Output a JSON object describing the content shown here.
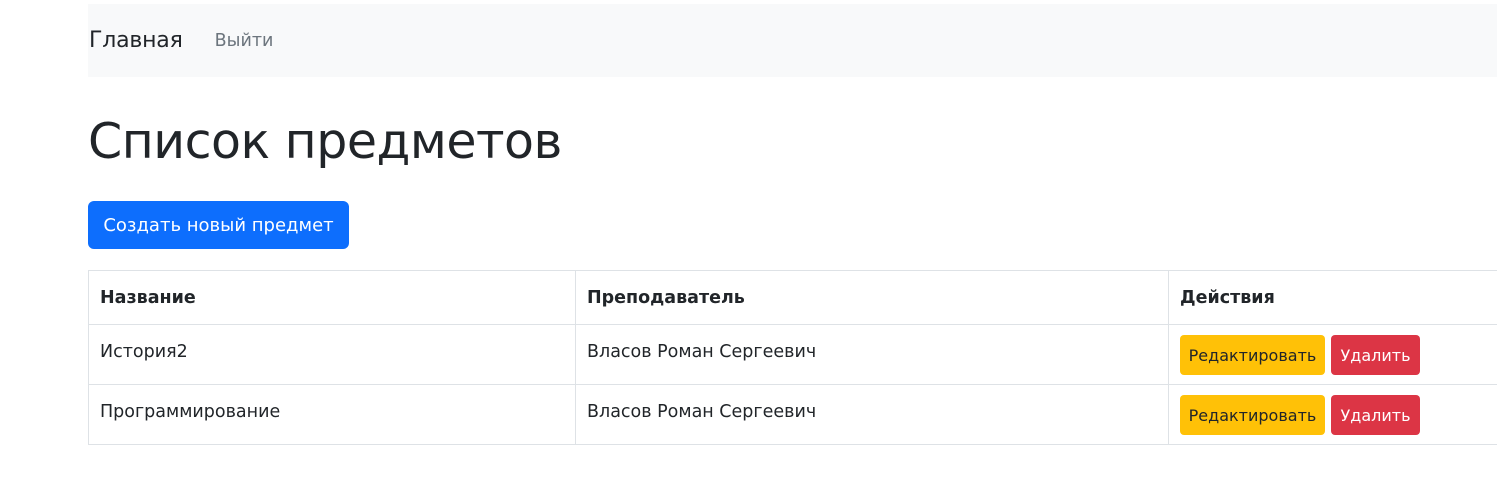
{
  "navbar": {
    "brand": "Главная",
    "logout_label": "Выйти"
  },
  "page": {
    "title": "Список предметов",
    "create_button_label": "Создать новый предмет"
  },
  "table": {
    "headers": [
      "Название",
      "Преподаватель",
      "Действия"
    ],
    "rows": [
      {
        "name": "История2",
        "teacher": "Власов Роман Сергеевич",
        "edit_label": "Редактировать",
        "delete_label": "Удалить"
      },
      {
        "name": "Программирование",
        "teacher": "Власов Роман Сергеевич",
        "edit_label": "Редактировать",
        "delete_label": "Удалить"
      }
    ]
  },
  "colors": {
    "primary": "#0d6efd",
    "warning": "#ffc107",
    "danger": "#dc3545",
    "navbar_bg": "#f8f9fa"
  }
}
